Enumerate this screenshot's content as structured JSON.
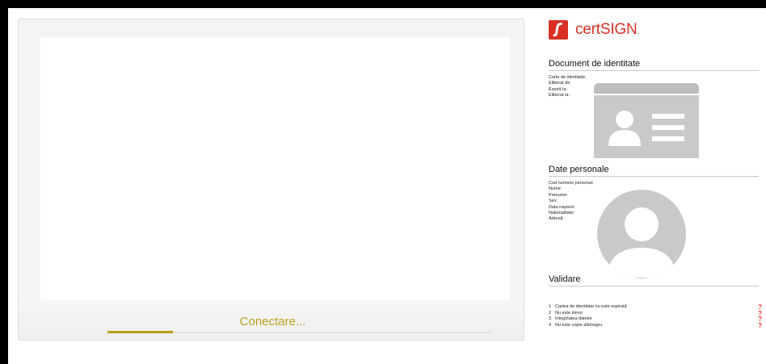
{
  "connection": {
    "status_text": "Conectare...",
    "progress_fraction": 0.17
  },
  "brand": {
    "name": "certSIGN",
    "name_suffix": ".",
    "color": "#d93025",
    "accent_color": "#b5a019"
  },
  "identity_document": {
    "title": "Document de identitate",
    "fields": [
      "Carte de identitate:",
      "Eliberat de:",
      "Expiră la:",
      "Eliberat la:"
    ],
    "placeholder_icon": "id-card-icon"
  },
  "personal_data": {
    "title": "Date personale",
    "fields": [
      "Cod numeric personal:",
      "Nume:",
      "Prenume:",
      "Sex:",
      "Data nașterii:",
      "Naționalitate:",
      "Adresă:"
    ],
    "placeholder_icon": "user-avatar-icon"
  },
  "validation": {
    "title": "Validare",
    "items": [
      {
        "num": "1",
        "text": "Cartea de identitate nu este expirată",
        "status": "?"
      },
      {
        "num": "2",
        "text": "Nu este minor",
        "status": "?"
      },
      {
        "num": "3",
        "text": "Integritatea datelor",
        "status": "?"
      },
      {
        "num": "4",
        "text": "Nu este copie alb/negru",
        "status": "?"
      }
    ]
  }
}
